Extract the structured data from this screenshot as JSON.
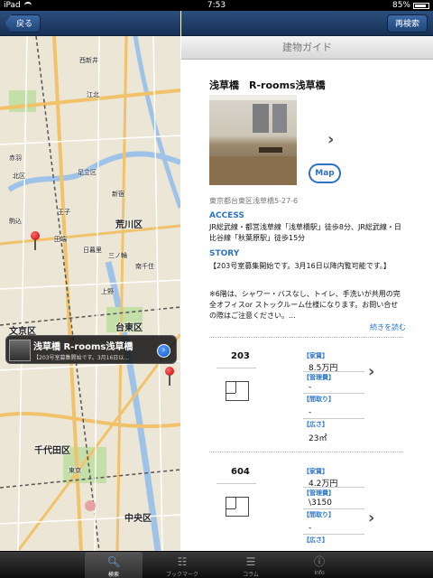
{
  "status_bar": {
    "carrier": "iPad",
    "time": "7:53",
    "battery_text": "85%",
    "battery_level": 0.85
  },
  "map_nav": {
    "back_label": "戻る"
  },
  "detail_nav": {
    "research_label": "再検索"
  },
  "detail": {
    "header_title": "建物ガイド",
    "building_name": "浅草橋　R-rooms浅草橋",
    "map_button_label": "Map",
    "address": "東京都台東区浅草橋5-27-6",
    "access_label": "ACCESS",
    "access_text": "JR総武線・都営浅草線「浅草橋駅」徒歩8分、JR総武線・日比谷線「秋葉原駅」徒歩15分",
    "story_label": "STORY",
    "story_text_1": "【203号室募集開始です。3月16日以降内覧可能です。】",
    "story_text_2": "※6階は、シャワー・バスなし、トイレ、手洗いが共用の完全オフィスor ストックルーム仕様になります。お問い合せの際はご注意ください。...",
    "more_label": "続きを読む"
  },
  "units": [
    {
      "room": "203",
      "rent_label": "【家賃】",
      "rent": "8.5万円",
      "fee_label": "【管理費】",
      "fee": "-",
      "deposit_label": "【間取り】",
      "deposit": "-",
      "area_label": "【広さ】",
      "area": "23㎡"
    },
    {
      "room": "604",
      "rent_label": "【家賃】",
      "rent": "4.2万円",
      "fee_label": "【管理費】",
      "fee": "\\3150",
      "deposit_label": "【間取り】",
      "deposit": "-",
      "area_label": "【広さ】",
      "area": "-"
    }
  ],
  "map": {
    "callout_title": "浅草橋 R-rooms浅草橋",
    "callout_sub": "【203号室募集開始です。3月16日以...",
    "labels": {
      "l1": "西新井",
      "l2": "江北",
      "l3": "王子",
      "l4": "赤羽",
      "l5": "荒川区",
      "l6": "田端",
      "l7": "日暮里",
      "l8": "文京区",
      "l9": "台東区",
      "l10": "千代田区",
      "l11": "中央区",
      "l12": "東京",
      "l13": "足立区",
      "l14": "北区",
      "l15": "駒込",
      "l16": "上野",
      "l17": "三ノ輪",
      "l18": "南千住",
      "l19": "新宿"
    }
  },
  "tab_bar": {
    "items": [
      {
        "label": "検索",
        "icon": "search-icon"
      },
      {
        "label": "ブックマーク",
        "icon": "book-icon"
      },
      {
        "label": "コラム",
        "icon": "list-icon"
      },
      {
        "label": "Info",
        "icon": "info-icon"
      }
    ]
  },
  "colors": {
    "nav": "#1f3f6a",
    "accent": "#2a74c9",
    "pin": "#c00000"
  }
}
